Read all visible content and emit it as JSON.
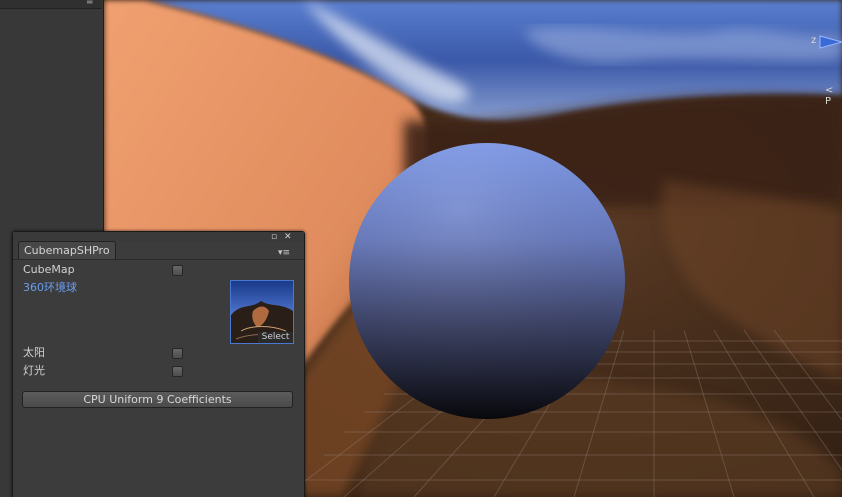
{
  "left_panel": {
    "menu_glyph": "≡"
  },
  "scene": {
    "gizmo_axis_z": "z",
    "gizmo_persp_label": "< P"
  },
  "window": {
    "tab_label": "CubemapSHPro",
    "maximize_glyph": "▫",
    "close_glyph": "✕",
    "tab_menu_glyph": "▾≡",
    "cubemap_label": "CubeMap",
    "cubemap_checked": false,
    "texture_label": "360环境球",
    "texture_select_label": "Select",
    "sun_label": "太阳",
    "sun_checked": false,
    "light_label": "灯光",
    "light_checked": false,
    "compute_button_label": "CPU Uniform 9 Coefficients"
  },
  "colors": {
    "sky_blue": "#3f63b8",
    "sand": "#e8966a",
    "ground": "#4a3322",
    "sphere_top": "#7c97e6",
    "sphere_bottom": "#0e0e14",
    "texture_label": "#6b9df2"
  },
  "icons": {
    "gizmo_z_arrow": "blue-cone-icon",
    "close": "close-icon",
    "maximize": "maximize-icon",
    "tab_menu": "menu-icon",
    "thumbnail": "environment-cubemap-thumbnail"
  }
}
